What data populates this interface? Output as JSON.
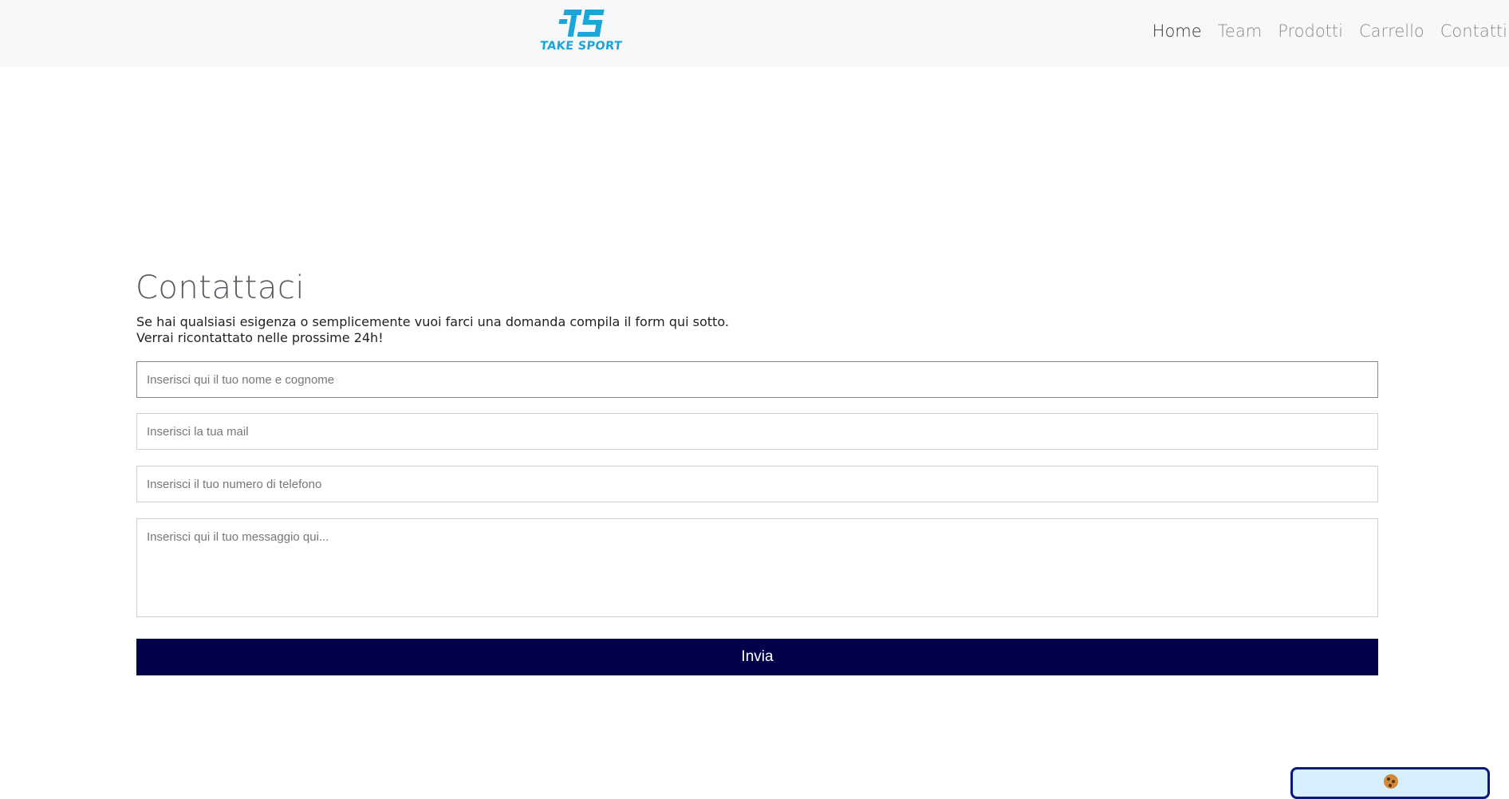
{
  "header": {
    "logo_text": "TAKE SPORT",
    "nav": [
      "Home",
      "Team",
      "Prodotti",
      "Carrello",
      "Contatti"
    ],
    "active_nav": "Home",
    "colors": {
      "logo": "#1aa6d9",
      "background": "#f7f8fa"
    }
  },
  "contact": {
    "title": "Contattaci",
    "intro_line1": "Se hai qualsiasi esigenza o semplicemente vuoi farci una domanda compila il form qui sotto.",
    "intro_line2": "Verrai ricontattato nelle prossime 24h!",
    "name_placeholder": "Inserisci qui il tuo nome e cognome",
    "email_placeholder": "Inserisci la tua mail",
    "phone_placeholder": "Inserisci il tuo numero di telefono",
    "message_placeholder": "Inserisci qui il tuo messaggio qui...",
    "submit_label": "Invia",
    "colors": {
      "submit": "#03004a"
    }
  },
  "cookie_banner": {
    "icon": "cookie-icon",
    "colors": {
      "background": "#d8efff",
      "border": "#0b1a7a"
    }
  }
}
